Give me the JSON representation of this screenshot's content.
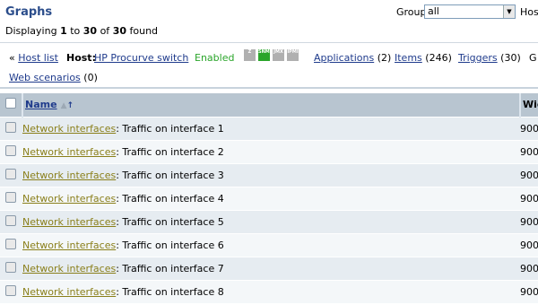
{
  "page": {
    "title": "Graphs",
    "found_prefix": "Displaying ",
    "found_from": "1",
    "found_to_word": " to ",
    "found_to": "30",
    "found_of_word": " of ",
    "found_total": "30",
    "found_suffix": " found",
    "group_label": "Group",
    "group_value": "all",
    "host_label": "Host"
  },
  "nav": {
    "back_prefix": "« ",
    "host_list": "Host list",
    "host_label": "Host:",
    "host_name": "HP Procurve switch",
    "status": "Enabled",
    "availability_icons": [
      {
        "name": "zabbix-agent-icon",
        "text": "Z",
        "color": "#b0b0b0"
      },
      {
        "name": "snmp-icon",
        "text": "SNMP",
        "color": "#2aa52a"
      },
      {
        "name": "jmx-icon",
        "text": "JMX",
        "color": "#b0b0b0"
      },
      {
        "name": "ipmi-icon",
        "text": "IPMI",
        "color": "#b0b0b0"
      }
    ],
    "applications": "Applications",
    "applications_count": "(2)",
    "items": "Items",
    "items_count": "(246)",
    "triggers": "Triggers",
    "triggers_count": "(30)",
    "graphs_partial": "G",
    "web_scenarios": "Web scenarios",
    "web_scenarios_count": "(0)"
  },
  "table": {
    "col_name": "Name",
    "col_width": "Wid",
    "rows": [
      {
        "app": "Network interfaces",
        "name": ": Traffic on interface 1",
        "width": "900"
      },
      {
        "app": "Network interfaces",
        "name": ": Traffic on interface 2",
        "width": "900"
      },
      {
        "app": "Network interfaces",
        "name": ": Traffic on interface 3",
        "width": "900"
      },
      {
        "app": "Network interfaces",
        "name": ": Traffic on interface 4",
        "width": "900"
      },
      {
        "app": "Network interfaces",
        "name": ": Traffic on interface 5",
        "width": "900"
      },
      {
        "app": "Network interfaces",
        "name": ": Traffic on interface 6",
        "width": "900"
      },
      {
        "app": "Network interfaces",
        "name": ": Traffic on interface 7",
        "width": "900"
      },
      {
        "app": "Network interfaces",
        "name": ": Traffic on interface 8",
        "width": "900"
      }
    ]
  }
}
